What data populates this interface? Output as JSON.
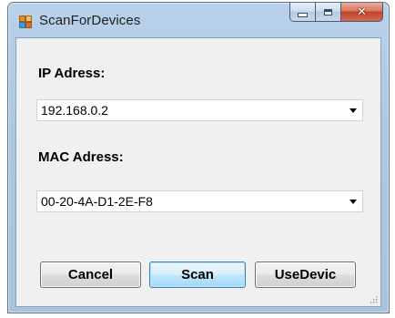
{
  "window": {
    "title": "ScanForDevices",
    "app_icon": "window-app-icon",
    "caption_buttons": {
      "minimize": "minimize-icon",
      "maximize": "maximize-icon",
      "close": "close-icon",
      "close_glyph": "✕"
    }
  },
  "form": {
    "ip_label": "IP Adress:",
    "ip_value": "192.168.0.2",
    "mac_label": "MAC Adress:",
    "mac_value": "00-20-4A-D1-2E-F8"
  },
  "buttons": {
    "cancel": "Cancel",
    "scan": "Scan",
    "use_device": "UseDevic"
  },
  "colors": {
    "frame": "#b9d1ea",
    "client": "#f0f0f0",
    "close_button": "#c4422a",
    "default_button_border": "#3c7fb1"
  }
}
